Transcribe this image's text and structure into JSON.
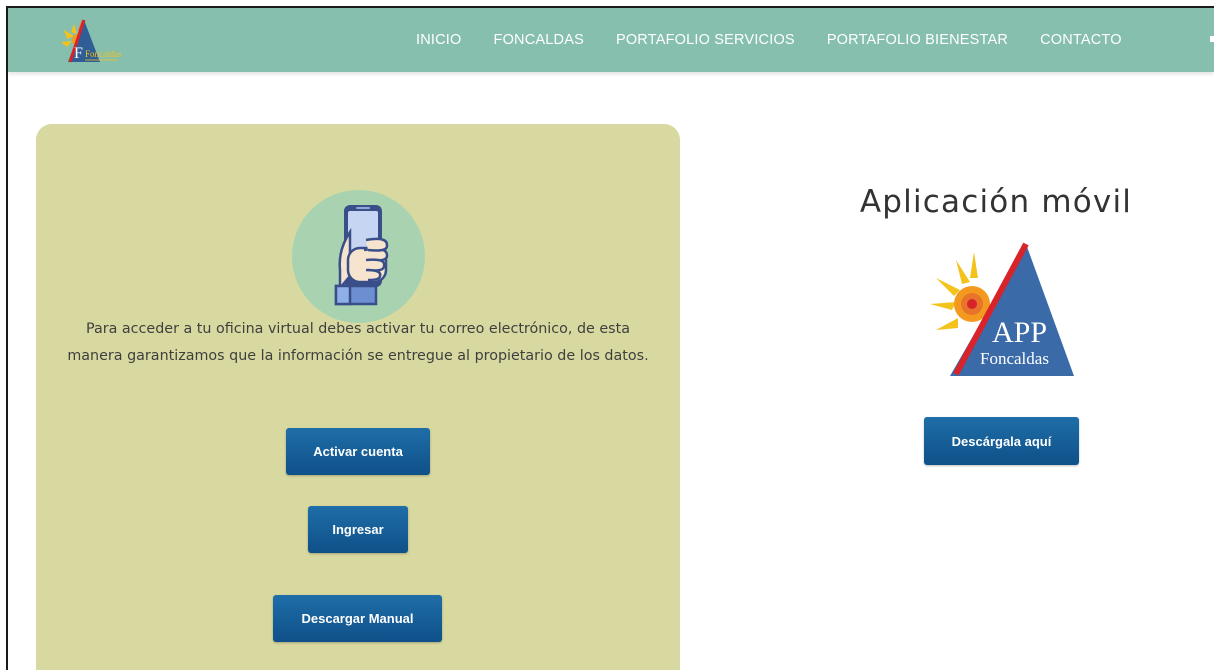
{
  "nav": {
    "logo_text": "Foncaldas",
    "items": [
      {
        "label": "INICIO"
      },
      {
        "label": "FONCALDAS"
      },
      {
        "label": "PORTAFOLIO SERVICIOS"
      },
      {
        "label": "PORTAFOLIO BIENESTAR"
      },
      {
        "label": "CONTACTO"
      }
    ]
  },
  "panel": {
    "icon": "hand-holding-phone-icon",
    "text": "Para acceder a tu oficina virtual debes activar tu correo electrónico, de esta manera garantizamos que la información se entregue al propietario de los datos.",
    "buttons": {
      "activate_label": "Activar cuenta",
      "login_label": "Ingresar",
      "manual_label": "Descargar Manual"
    }
  },
  "app": {
    "title": "Aplicación móvil",
    "logo_line1": "APP",
    "logo_line2": "Foncaldas",
    "download_label": "Descárgala aquí"
  },
  "colors": {
    "navbar": "#86bfad",
    "panel": "#d8d9a0",
    "button": "#155d98",
    "icon_circle": "#a9d3b0"
  }
}
